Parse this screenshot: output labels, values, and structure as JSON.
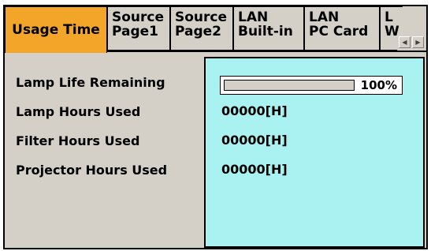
{
  "tabs": [
    {
      "label": "Usage Time"
    },
    {
      "label": "Source\nPage1"
    },
    {
      "label": "Source\nPage2"
    },
    {
      "label": "LAN\nBuilt-in"
    },
    {
      "label": "LAN\nPC Card"
    },
    {
      "label": "L\nW"
    }
  ],
  "scroll": {
    "left": "◀",
    "right": "▶"
  },
  "rows": [
    {
      "label": "Lamp Life Remaining",
      "value": "100%",
      "percent": 100
    },
    {
      "label": "Lamp Hours Used",
      "value": "00000[H]"
    },
    {
      "label": "Filter Hours Used",
      "value": "00000[H]"
    },
    {
      "label": "Projector Hours Used",
      "value": "00000[H]"
    }
  ],
  "colors": {
    "active_tab": "#f3a52a",
    "value_panel": "#aaf2f2",
    "panel_bg": "#d4d0c8"
  }
}
